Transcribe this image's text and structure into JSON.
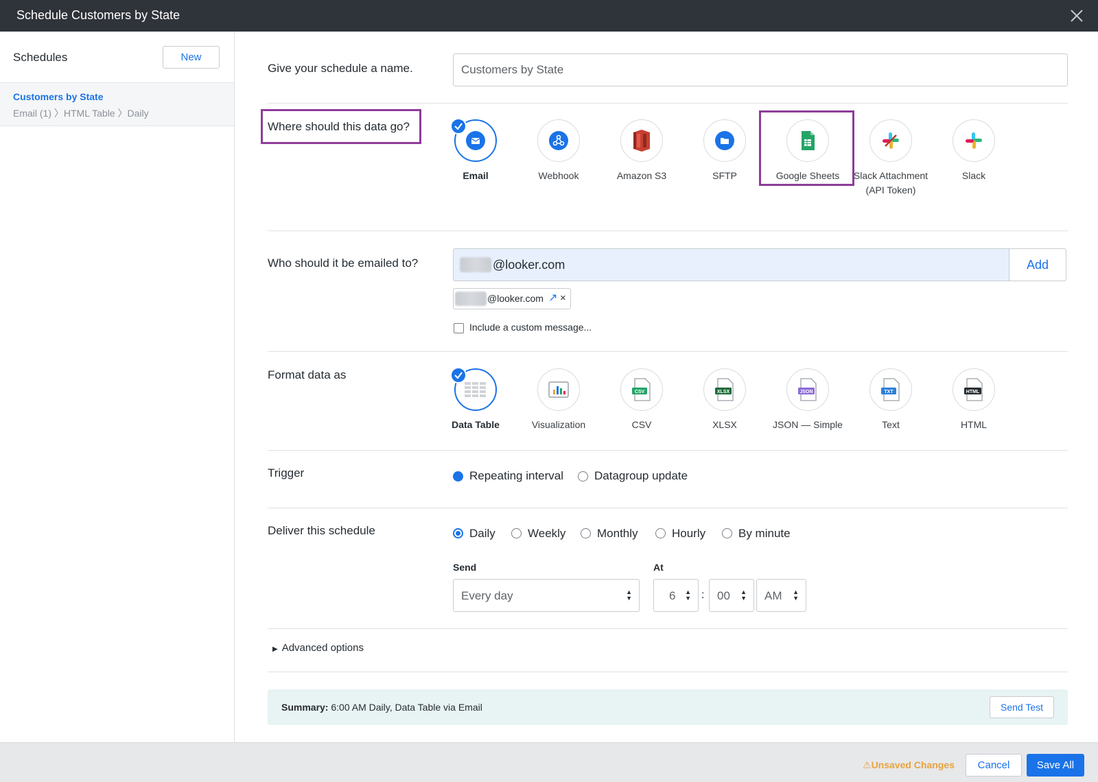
{
  "window": {
    "title": "Schedule Customers by State"
  },
  "sidebar": {
    "heading": "Schedules",
    "new_label": "New",
    "items": [
      {
        "name": "Customers by State",
        "path": "Email (1) 〉HTML Table 〉Daily"
      }
    ]
  },
  "schedule_name": {
    "label": "Give your schedule a name.",
    "value": "Customers by State"
  },
  "destination": {
    "label": "Where should this data go?",
    "options": [
      {
        "label": "Email",
        "icon": "email-icon",
        "selected": true
      },
      {
        "label": "Webhook",
        "icon": "webhook-icon"
      },
      {
        "label": "Amazon S3",
        "icon": "amazon-s3-icon"
      },
      {
        "label": "SFTP",
        "icon": "sftp-icon"
      },
      {
        "label": "Google Sheets",
        "icon": "google-sheets-icon"
      },
      {
        "label": "Slack Attachment (API Token)",
        "icon": "slack-icon"
      },
      {
        "label": "Slack",
        "icon": "slack-icon"
      }
    ]
  },
  "recipients": {
    "label": "Who should it be emailed to?",
    "input_value": "@looker.com",
    "add_label": "Add",
    "chips": [
      {
        "text": "@looker.com"
      }
    ],
    "custom_message_label": "Include a custom message..."
  },
  "format": {
    "label": "Format data as",
    "options": [
      {
        "label": "Data Table",
        "icon": "data-table-icon",
        "selected": true
      },
      {
        "label": "Visualization",
        "icon": "visualization-icon"
      },
      {
        "label": "CSV",
        "icon": "csv-icon"
      },
      {
        "label": "XLSX",
        "icon": "xlsx-icon"
      },
      {
        "label": "JSON — Simple",
        "icon": "json-icon"
      },
      {
        "label": "Text",
        "icon": "txt-icon"
      },
      {
        "label": "HTML",
        "icon": "html-icon"
      }
    ]
  },
  "trigger": {
    "label": "Trigger",
    "options": [
      {
        "label": "Repeating interval",
        "selected": true
      },
      {
        "label": "Datagroup update"
      }
    ]
  },
  "delivery": {
    "label": "Deliver this schedule",
    "options": [
      {
        "label": "Daily",
        "selected": true
      },
      {
        "label": "Weekly"
      },
      {
        "label": "Monthly"
      },
      {
        "label": "Hourly"
      },
      {
        "label": "By minute"
      }
    ],
    "send_label": "Send",
    "send_value": "Every day",
    "at_label": "At",
    "hour": "6",
    "colon": ":",
    "minute": "00",
    "ampm": "AM"
  },
  "advanced": {
    "label": "Advanced options"
  },
  "summary": {
    "label": "Summary:",
    "text": "6:00 AM Daily, Data Table via Email",
    "send_test_label": "Send Test"
  },
  "footer": {
    "unsaved_label": "Unsaved Changes",
    "cancel_label": "Cancel",
    "save_label": "Save All"
  },
  "colors": {
    "accent": "#1a73e8",
    "highlight": "#8e3c99",
    "titlebar": "#2f333a",
    "warning": "#e8a33d"
  }
}
